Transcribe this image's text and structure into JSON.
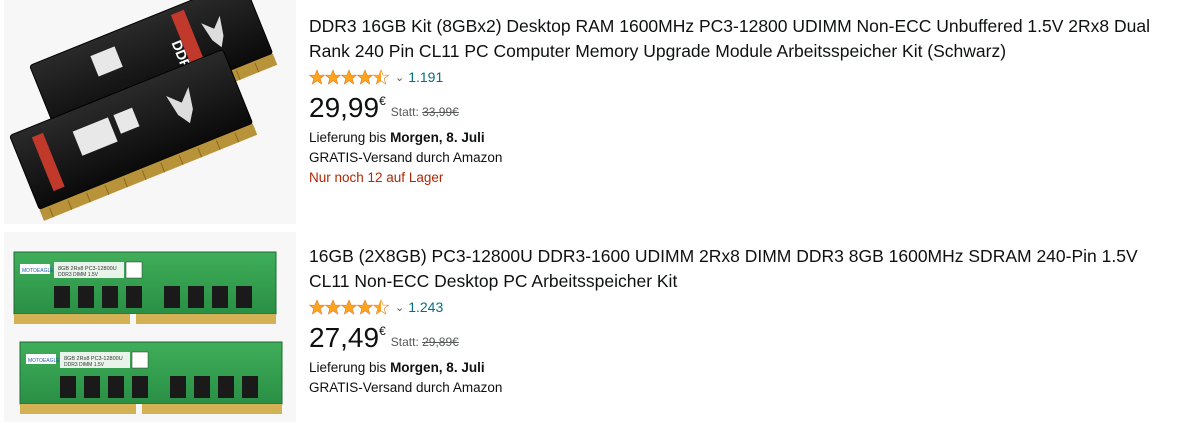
{
  "products": [
    {
      "title": "DDR3 16GB Kit (8GBx2) Desktop RAM 1600MHz PC3-12800 UDIMM Non-ECC Unbuffered 1.5V 2Rx8 Dual Rank 240 Pin CL11 PC Computer Memory Upgrade Module Arbeitsspeicher Kit (Schwarz)",
      "rating": 4.5,
      "rating_count": "1.191",
      "price_whole": "29,99",
      "currency": "€",
      "statt_label": "Statt:",
      "old_price": "33,99€",
      "delivery_prefix": "Lieferung bis ",
      "delivery_date": "Morgen, 8. Juli",
      "shipping": "GRATIS-Versand durch Amazon",
      "stock": "Nur noch 12 auf Lager",
      "image": {
        "alt": "two black ddr3 ram modules with dragon logo",
        "label": "DDR3"
      }
    },
    {
      "title": "16GB (2X8GB) PC3-12800U DDR3-1600 UDIMM 2Rx8 DIMM DDR3 8GB 1600MHz SDRAM 240-Pin 1.5V CL11 Non-ECC Desktop PC Arbeitsspeicher Kit",
      "rating": 4.5,
      "rating_count": "1.243",
      "price_whole": "27,49",
      "currency": "€",
      "statt_label": "Statt:",
      "old_price": "29,89€",
      "delivery_prefix": "Lieferung bis ",
      "delivery_date": "Morgen, 8. Juli",
      "shipping": "GRATIS-Versand durch Amazon",
      "image": {
        "alt": "two green ddr3 ram modules",
        "label": "8GB 2Rx8 PC3-12800U",
        "sublabel": "DDR3 DIMM 1.5V",
        "brand": "MOTOEAGLE"
      }
    }
  ],
  "colors": {
    "star": "#ffa41c",
    "link": "#007185",
    "stock": "#b12704",
    "muted": "#565959"
  },
  "icons": {
    "star": "star-icon",
    "chevron": "chevron-down-icon"
  }
}
